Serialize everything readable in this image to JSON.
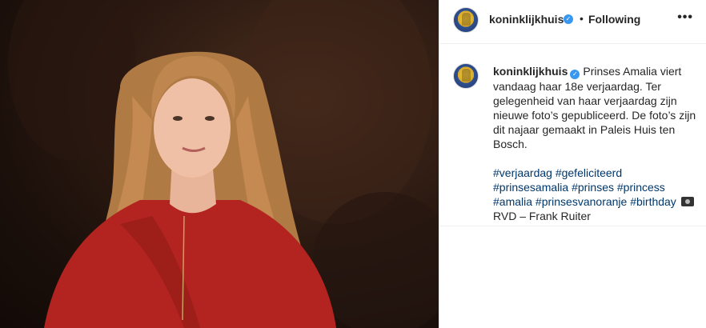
{
  "photo": {
    "alt": "portrait-photo"
  },
  "post": {
    "username": "koninklijkhuis",
    "follow_status": "Following",
    "dot": "•",
    "more": "•••"
  },
  "caption": {
    "username": "koninklijkhuis",
    "text": "Prinses Amalia viert vandaag haar 18e verjaardag. Ter gelegenheid van haar verjaardag zijn nieuwe foto’s gepubliceerd. De foto’s zijn dit najaar gemaakt in Paleis Huis ten Bosch.",
    "hashtags": [
      "#verjaardag",
      "#gefeliciteerd",
      "#prinsesamalia",
      "#prinses",
      "#princess",
      "#amalia",
      "#prinsesvanoranje",
      "#birthday"
    ],
    "credit": "RVD – Frank Ruiter"
  },
  "colors": {
    "link": "#00376b",
    "verified": "#3897f0",
    "dress": "#b3231f"
  }
}
